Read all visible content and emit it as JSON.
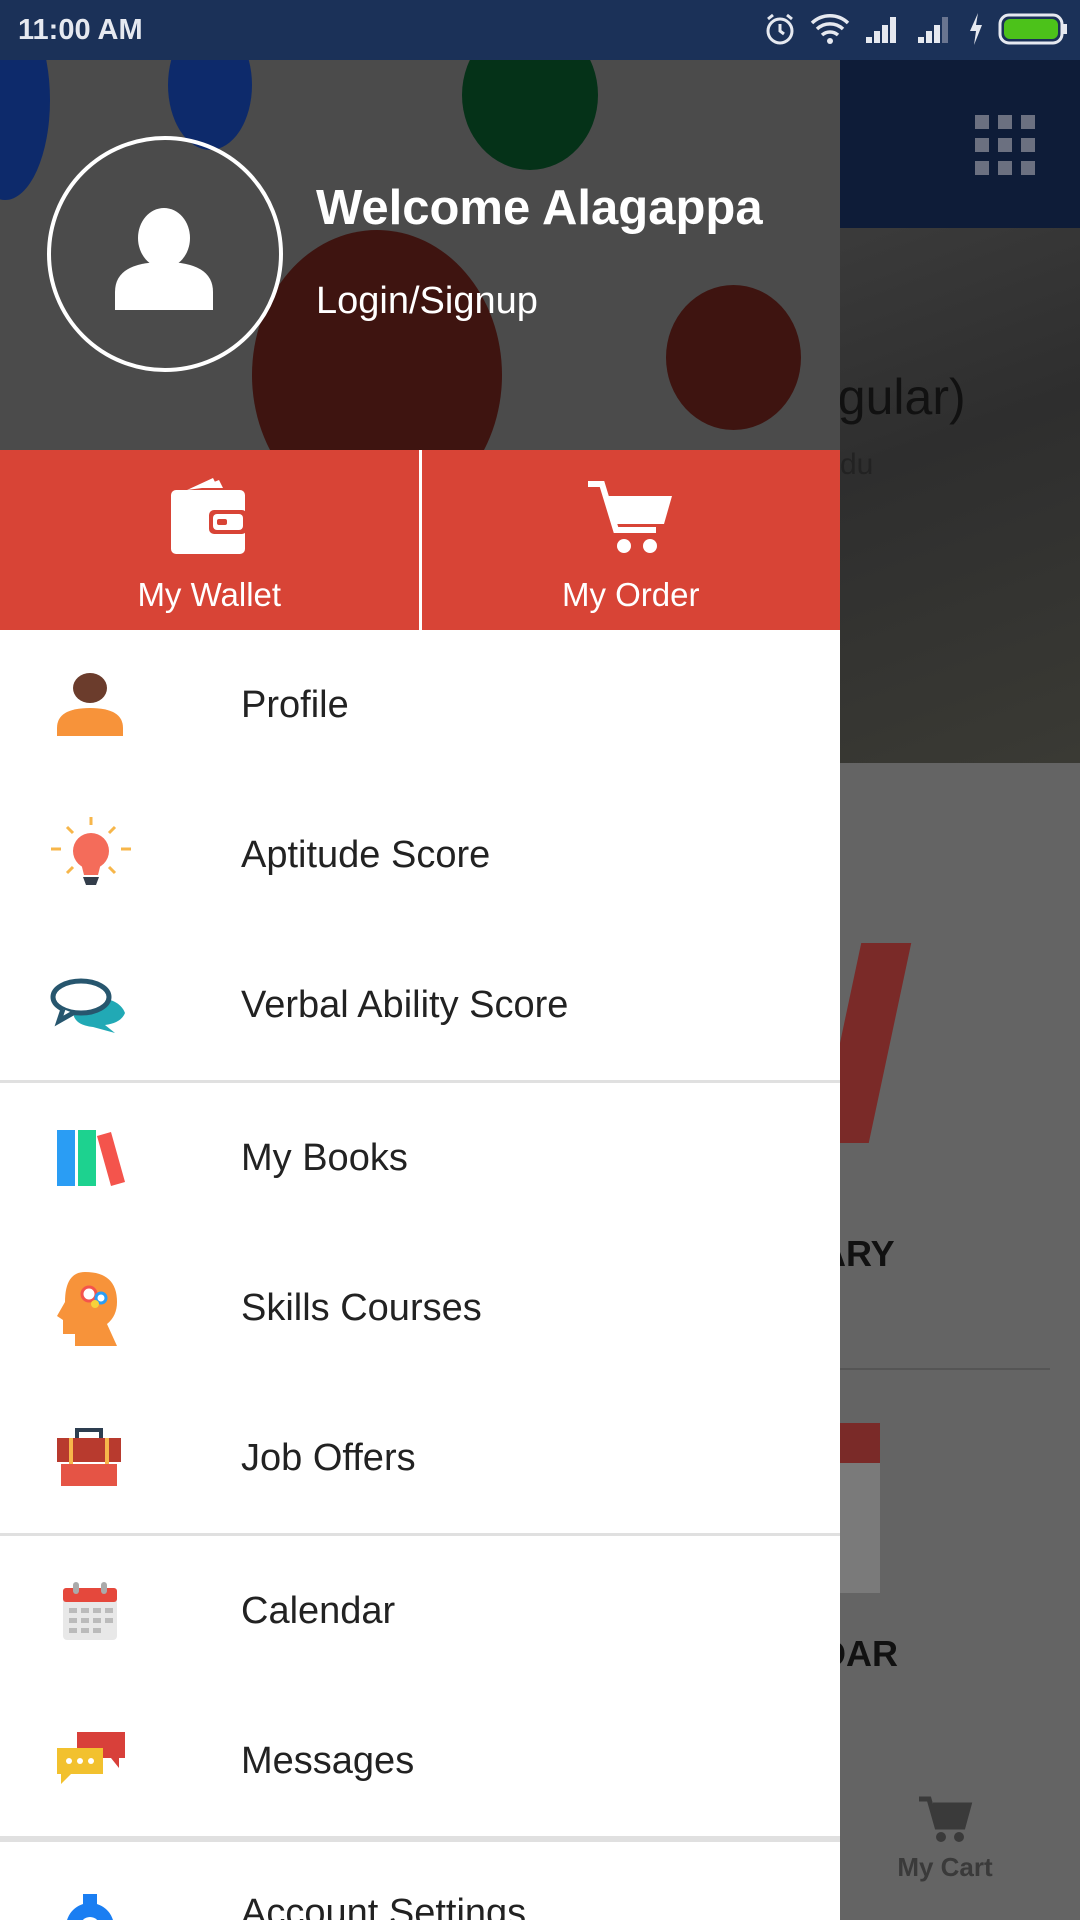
{
  "status_bar": {
    "time": "11:00 AM",
    "icons": [
      "alarm-icon",
      "wifi-icon",
      "signal-icon",
      "signal-icon",
      "charging-icon",
      "battery-icon"
    ],
    "battery_color": "#4cc21a"
  },
  "background": {
    "title_fragment": "egular)",
    "subtitle_fragment": "du",
    "label_library": "ARY",
    "label_calendar": "DAR",
    "cart_label": "My Cart"
  },
  "drawer": {
    "welcome": "Welcome Alagappa",
    "login": "Login/Signup",
    "quick_actions": [
      {
        "label": "My Wallet",
        "icon": "wallet-icon"
      },
      {
        "label": "My Order",
        "icon": "cart-icon"
      }
    ],
    "accent": "#d84436",
    "groups": [
      [
        {
          "label": "Profile",
          "icon": "profile-icon"
        },
        {
          "label": "Aptitude Score",
          "icon": "lightbulb-icon"
        },
        {
          "label": "Verbal Ability Score",
          "icon": "chat-bubbles-icon"
        }
      ],
      [
        {
          "label": "My Books",
          "icon": "books-icon"
        },
        {
          "label": "Skills Courses",
          "icon": "brain-head-icon"
        },
        {
          "label": "Job Offers",
          "icon": "briefcase-icon"
        }
      ],
      [
        {
          "label": "Calendar",
          "icon": "calendar-icon"
        },
        {
          "label": "Messages",
          "icon": "messages-icon"
        }
      ],
      [
        {
          "label": "Account Settings",
          "icon": "gear-icon"
        }
      ]
    ]
  }
}
